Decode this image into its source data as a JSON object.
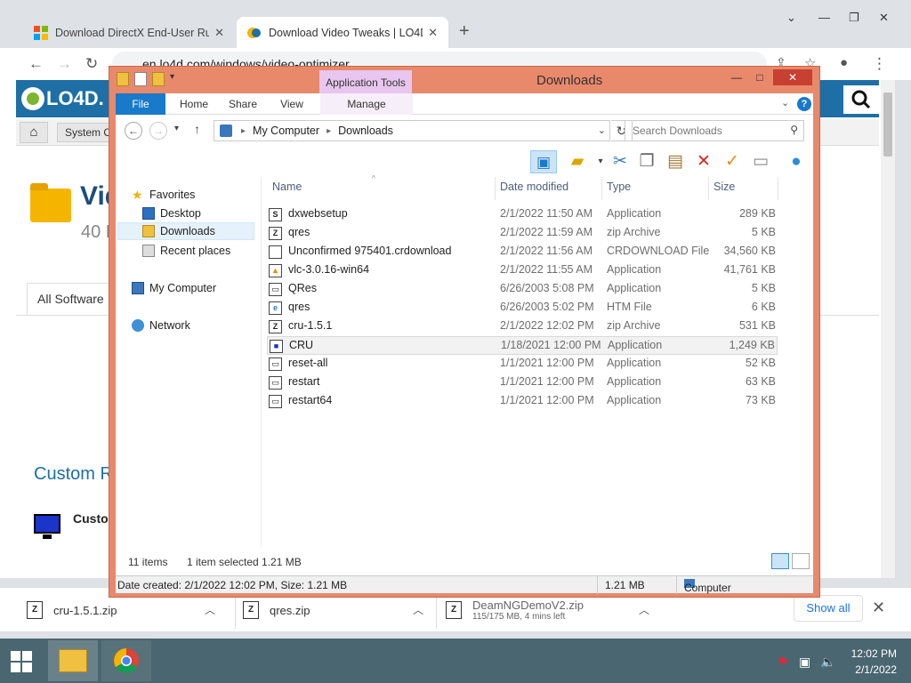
{
  "browser": {
    "tabs": [
      {
        "title": "Download DirectX End-User Run",
        "active": false
      },
      {
        "title": "Download Video Tweaks | LO4D.",
        "active": true
      }
    ],
    "address": "en.lo4d.com/windows/video-optimizer"
  },
  "page": {
    "logo": "LO4D.",
    "breadcrumb": "System O",
    "title": "Vid",
    "subtitle": "40 F",
    "tab_all_software": "All Software",
    "custom_heading": "Custom Re",
    "custom_item": "Custom"
  },
  "downloads": [
    {
      "name": "cru-1.5.1.zip",
      "progress": ""
    },
    {
      "name": "qres.zip",
      "progress": ""
    },
    {
      "name": "DeamNGDemoV2.zip",
      "progress": "115/175 MB, 4 mins left"
    }
  ],
  "show_all": "Show all",
  "explorer": {
    "title": "Downloads",
    "context_tab": "Application Tools",
    "ribbon_tabs": [
      "File",
      "Home",
      "Share",
      "View",
      "Manage"
    ],
    "path": [
      "My Computer",
      "Downloads"
    ],
    "search_placeholder": "Search Downloads",
    "nav": {
      "favorites": "Favorites",
      "desktop": "Desktop",
      "downloads": "Downloads",
      "recent": "Recent places",
      "computer": "My Computer",
      "network": "Network"
    },
    "columns": {
      "name": "Name",
      "date": "Date modified",
      "type": "Type",
      "size": "Size"
    },
    "files": [
      {
        "name": "dxwebsetup",
        "date": "2/1/2022 11:50 AM",
        "type": "Application",
        "size": "289 KB",
        "icon": "setup-icon"
      },
      {
        "name": "qres",
        "date": "2/1/2022 11:59 AM",
        "type": "zip Archive",
        "size": "5 KB",
        "icon": "zip-icon"
      },
      {
        "name": "Unconfirmed 975401.crdownload",
        "date": "2/1/2022 11:56 AM",
        "type": "CRDOWNLOAD File",
        "size": "34,560 KB",
        "icon": "file-icon"
      },
      {
        "name": "vlc-3.0.16-win64",
        "date": "2/1/2022 11:55 AM",
        "type": "Application",
        "size": "41,761 KB",
        "icon": "vlc-icon"
      },
      {
        "name": "QRes",
        "date": "6/26/2003 5:08 PM",
        "type": "Application",
        "size": "5 KB",
        "icon": "app-icon"
      },
      {
        "name": "qres",
        "date": "6/26/2003 5:02 PM",
        "type": "HTM File",
        "size": "6 KB",
        "icon": "htm-icon"
      },
      {
        "name": "cru-1.5.1",
        "date": "2/1/2022 12:02 PM",
        "type": "zip Archive",
        "size": "531 KB",
        "icon": "zip-icon"
      },
      {
        "name": "CRU",
        "date": "1/18/2021 12:00 PM",
        "type": "Application",
        "size": "1,249 KB",
        "icon": "monitor-icon"
      },
      {
        "name": "reset-all",
        "date": "1/1/2021 12:00 PM",
        "type": "Application",
        "size": "52 KB",
        "icon": "app-icon"
      },
      {
        "name": "restart",
        "date": "1/1/2021 12:00 PM",
        "type": "Application",
        "size": "63 KB",
        "icon": "app-icon"
      },
      {
        "name": "restart64",
        "date": "1/1/2021 12:00 PM",
        "type": "Application",
        "size": "73 KB",
        "icon": "app-icon"
      }
    ],
    "status": {
      "count": "11 items",
      "selected": "1 item selected  1.21 MB",
      "details": "Date created: 2/1/2022 12:02 PM, Size: 1.21 MB",
      "size": "1.21 MB",
      "location": "Computer"
    }
  },
  "taskbar": {
    "time": "12:02 PM",
    "date": "2/1/2022"
  },
  "colors": {
    "accent": "#1979ca",
    "window_frame": "#e9896b",
    "taskbar": "#4a6670",
    "close": "#c84031"
  }
}
